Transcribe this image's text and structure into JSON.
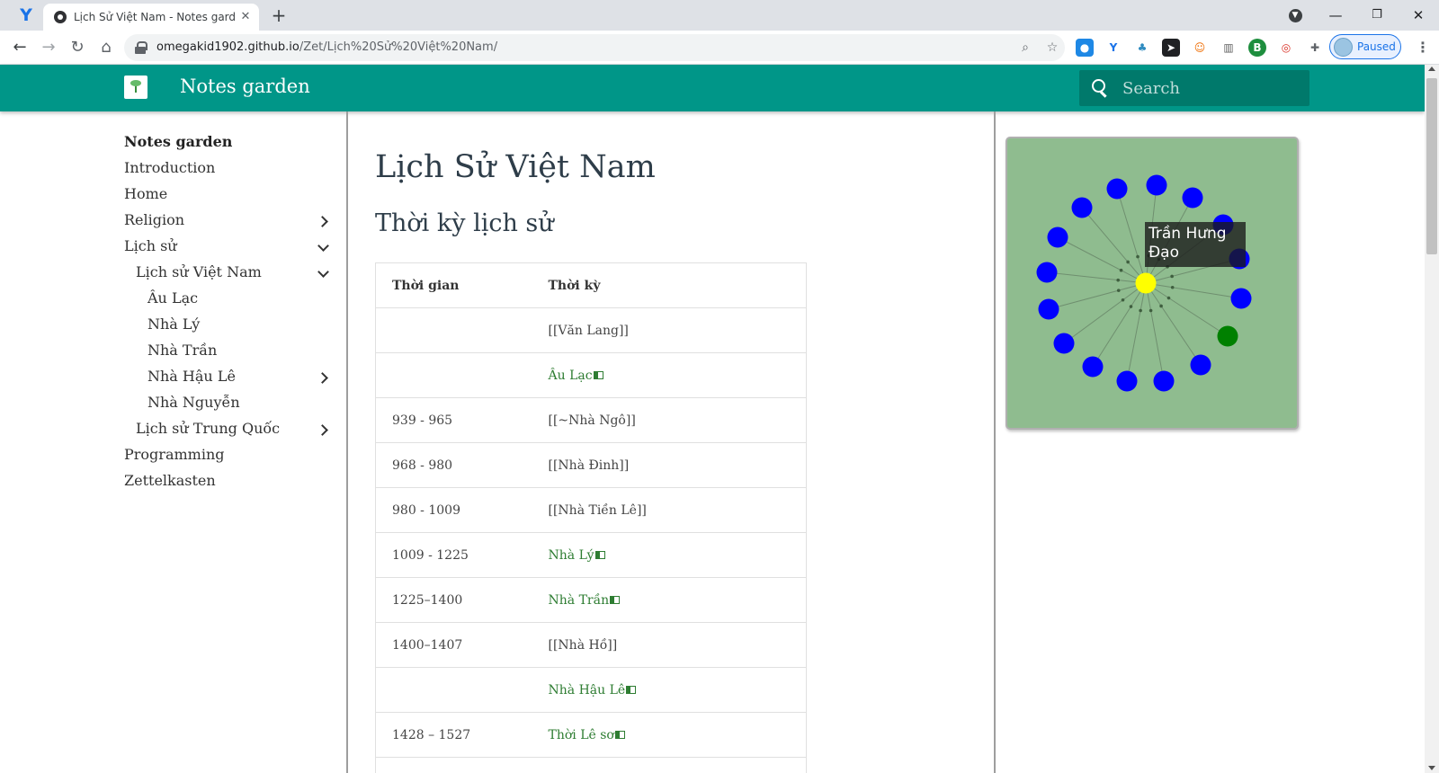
{
  "browser": {
    "tab_title": "Lịch Sử Việt Nam - Notes garden",
    "tab_close": "✕",
    "new_tab": "+",
    "url_host": "omegakid1902.github.io",
    "url_path": "/Zet/Lịch%20Sử%20Việt%20Nam/",
    "profile_label": "Paused"
  },
  "header": {
    "site_title": "Notes garden",
    "search_placeholder": "Search",
    "brand_color": "#009688"
  },
  "nav": {
    "items": [
      {
        "label": "Notes garden"
      },
      {
        "label": "Introduction"
      },
      {
        "label": "Home"
      },
      {
        "label": "Religion"
      },
      {
        "label": "Lịch sử"
      },
      {
        "label": "Lịch sử Việt Nam"
      },
      {
        "label": "Âu Lạc"
      },
      {
        "label": "Nhà Lý"
      },
      {
        "label": "Nhà Trần"
      },
      {
        "label": "Nhà Hậu Lê"
      },
      {
        "label": "Nhà Nguyễn"
      },
      {
        "label": "Lịch sử Trung Quốc"
      },
      {
        "label": "Programming"
      },
      {
        "label": "Zettelkasten"
      }
    ]
  },
  "content": {
    "page_title": "Lịch Sử Việt Nam",
    "section_title": "Thời kỳ lịch sử",
    "table": {
      "headers": [
        "Thời gian",
        "Thời kỳ"
      ],
      "rows": [
        {
          "time": "",
          "period": "[[Văn Lang]]",
          "link": false
        },
        {
          "time": "",
          "period": "Âu Lạc",
          "link": true
        },
        {
          "time": "939 - 965",
          "period": "[[~Nhà Ngô]]",
          "link": false
        },
        {
          "time": "968 - 980",
          "period": "[[Nhà Đinh]]",
          "link": false
        },
        {
          "time": "980 - 1009",
          "period": "[[Nhà Tiền Lê]]",
          "link": false
        },
        {
          "time": "1009 - 1225",
          "period": "Nhà Lý",
          "link": true
        },
        {
          "time": "1225–1400",
          "period": "Nhà Trần",
          "link": true
        },
        {
          "time": "1400–1407",
          "period": "[[Nhà Hồ]]",
          "link": false
        },
        {
          "time": "",
          "period": "Nhà Hậu Lê",
          "link": true
        },
        {
          "time": "1428 – 1527",
          "period": "Thời Lê sơ",
          "link": true
        },
        {
          "time": "",
          "period": "",
          "link": false
        }
      ]
    }
  },
  "graph": {
    "tooltip": "Trần Hưng Đạo",
    "background": "#8fbc8f",
    "center_color": "#ffff00",
    "node_color": "#0000ff",
    "highlight_color": "#008000"
  }
}
